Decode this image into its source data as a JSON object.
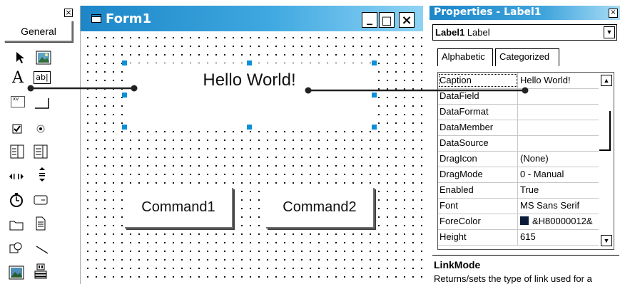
{
  "toolbox": {
    "close": "×",
    "tab_label": "General",
    "tools": [
      {
        "name": "pointer-icon"
      },
      {
        "name": "picturebox-icon"
      },
      {
        "name": "label-icon",
        "text": "A"
      },
      {
        "name": "textbox-icon",
        "text": "ab|"
      },
      {
        "name": "frame-icon",
        "text": "xv"
      },
      {
        "name": "commandbutton-icon"
      },
      {
        "name": "checkbox-icon"
      },
      {
        "name": "optionbutton-icon"
      },
      {
        "name": "combobox-icon"
      },
      {
        "name": "listbox-icon"
      },
      {
        "name": "hscrollbar-icon"
      },
      {
        "name": "vscrollbar-icon"
      },
      {
        "name": "timer-icon"
      },
      {
        "name": "drivelistbox-icon"
      },
      {
        "name": "dirlistbox-icon"
      },
      {
        "name": "filelistbox-icon"
      },
      {
        "name": "shape-icon"
      },
      {
        "name": "line-icon"
      },
      {
        "name": "image-icon"
      },
      {
        "name": "data-icon"
      }
    ]
  },
  "form": {
    "title": "Form1",
    "minimize": "_",
    "maximize": "□",
    "close": "×",
    "label_caption": "Hello World!",
    "buttons": [
      "Command1",
      "Command2"
    ]
  },
  "properties": {
    "title": "Properties - Label1",
    "close": "×",
    "object_name": "Label1",
    "object_type": "Label",
    "tabs": [
      "Alphabetic",
      "Categorized"
    ],
    "rows": [
      {
        "name": "Caption",
        "value": "Hello World!"
      },
      {
        "name": "DataField",
        "value": ""
      },
      {
        "name": "DataFormat",
        "value": ""
      },
      {
        "name": "DataMember",
        "value": ""
      },
      {
        "name": "DataSource",
        "value": ""
      },
      {
        "name": "DragIcon",
        "value": "(None)"
      },
      {
        "name": "DragMode",
        "value": "0 - Manual"
      },
      {
        "name": "Enabled",
        "value": "True"
      },
      {
        "name": "Font",
        "value": "MS Sans Serif"
      },
      {
        "name": "ForeColor",
        "value": "&H80000012&"
      },
      {
        "name": "Height",
        "value": "615"
      }
    ],
    "description_title": "LinkMode",
    "description_text": "Returns/sets the type of link used for a"
  },
  "colors": {
    "title_gradient_start": "#1c86c8",
    "handle": "#0a8fd9",
    "forecolor_swatch": "#0a1a3a"
  }
}
